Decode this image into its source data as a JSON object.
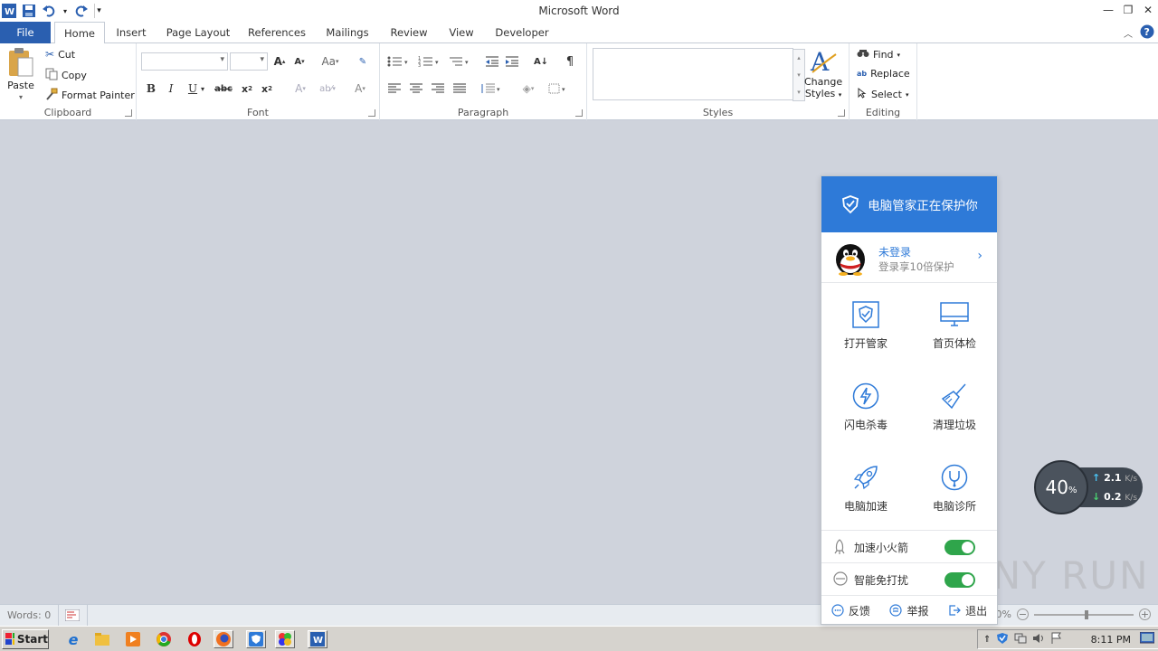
{
  "window": {
    "title": "Microsoft Word"
  },
  "tabs": [
    "File",
    "Home",
    "Insert",
    "Page Layout",
    "References",
    "Mailings",
    "Review",
    "View",
    "Developer"
  ],
  "ribbon": {
    "clipboard": {
      "label": "Clipboard",
      "paste": "Paste",
      "cut": "Cut",
      "copy": "Copy",
      "format_painter": "Format Painter"
    },
    "font": {
      "label": "Font",
      "font_name": "",
      "font_size": ""
    },
    "paragraph": {
      "label": "Paragraph"
    },
    "styles": {
      "label": "Styles",
      "change_styles": "Change",
      "change_styles2": "Styles"
    },
    "editing": {
      "label": "Editing",
      "find": "Find",
      "replace": "Replace",
      "select": "Select"
    }
  },
  "statusbar": {
    "words": "Words: 0",
    "zoom": "10%"
  },
  "taskbar": {
    "start": "Start",
    "time": "8:11 PM"
  },
  "popup": {
    "header": "电脑管家正在保护你",
    "user_name": "未登录",
    "user_sub": "登录享10倍保护",
    "grid": [
      "打开管家",
      "首页体检",
      "闪电杀毒",
      "清理垃圾",
      "电脑加速",
      "电脑诊所"
    ],
    "toggles": [
      {
        "label": "加速小火箭",
        "on": true
      },
      {
        "label": "智能免打扰",
        "on": true
      }
    ],
    "footer": [
      "反馈",
      "举报",
      "退出"
    ],
    "accent": "#2e7ad8"
  },
  "speed_widget": {
    "percent": "40",
    "percent_sign": "%",
    "up": "2.1",
    "down": "0.2",
    "unit": "K/s"
  },
  "watermark": "ANY RUN"
}
